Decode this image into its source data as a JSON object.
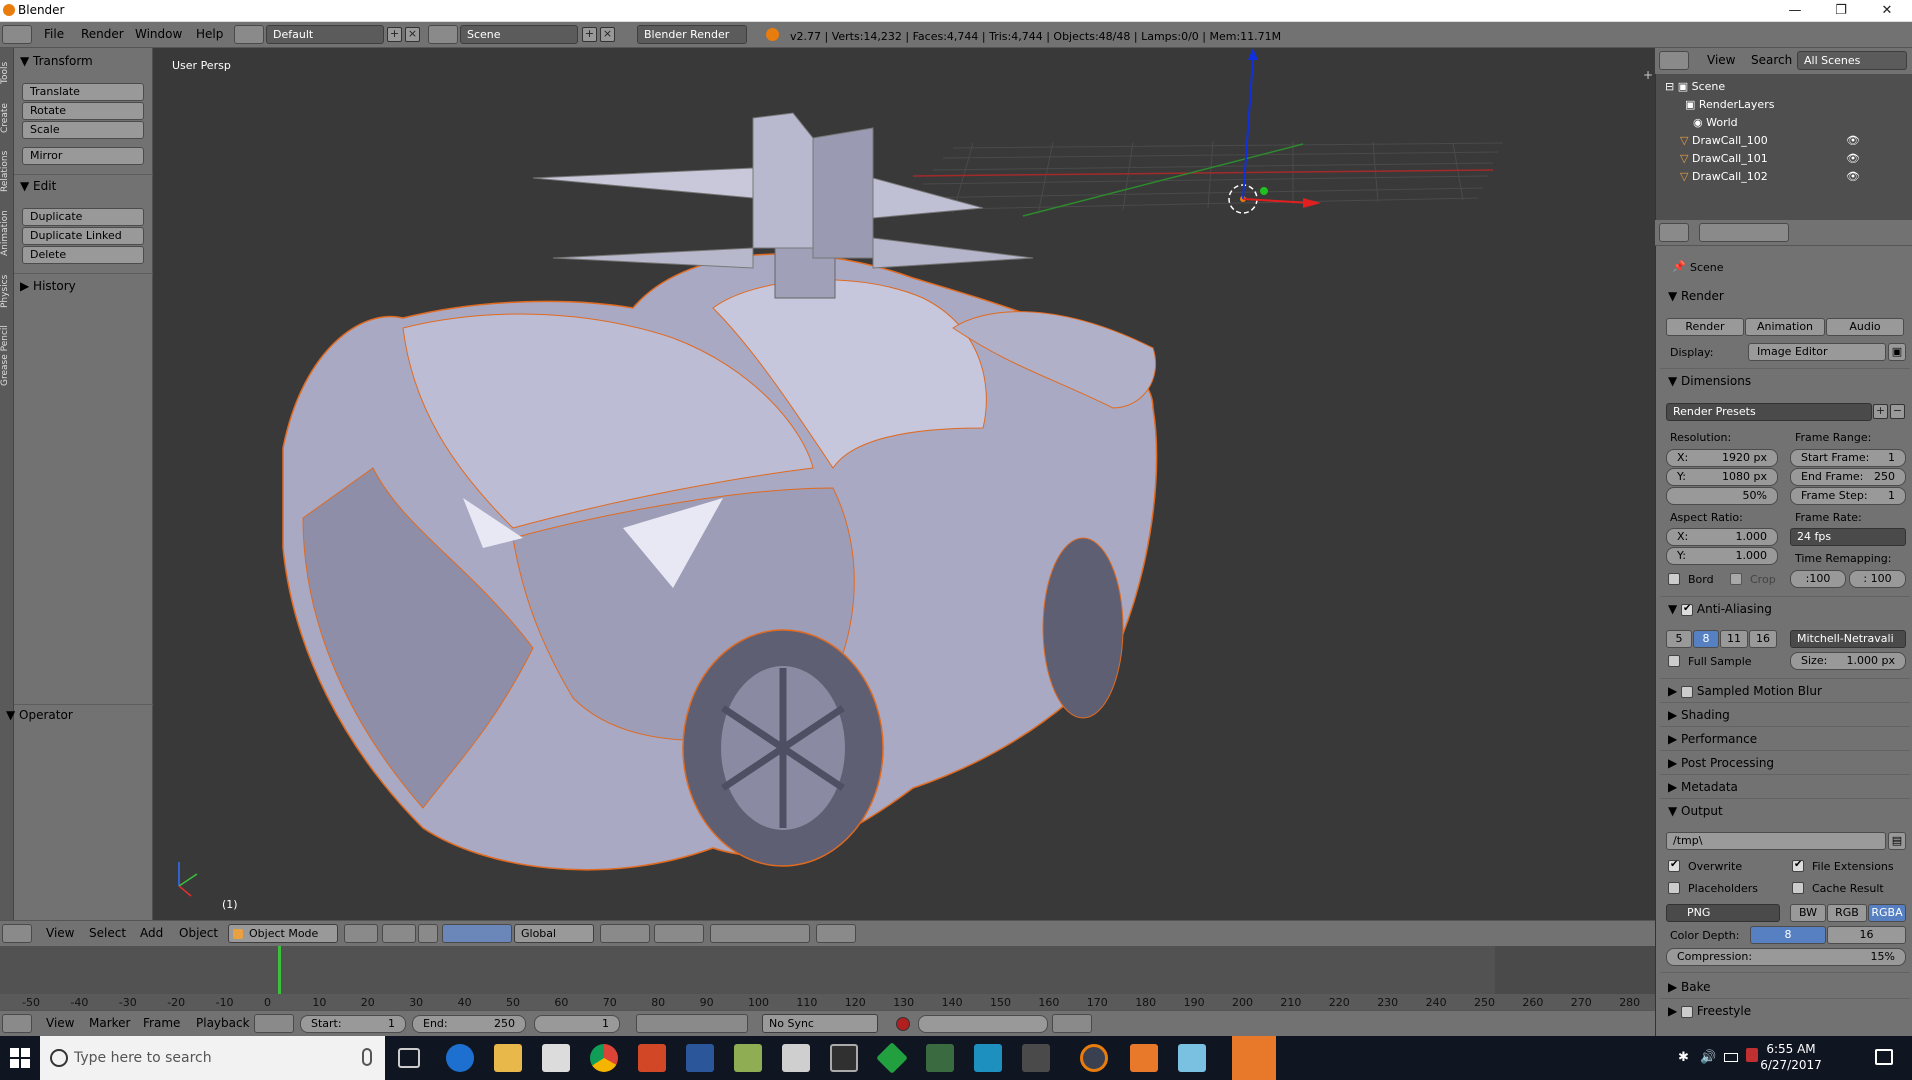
{
  "window": {
    "title": "Blender"
  },
  "header": {
    "menus": [
      "File",
      "Render",
      "Window",
      "Help"
    ],
    "layout": "Default",
    "scene": "Scene",
    "engine": "Blender Render",
    "stats": "v2.77 | Verts:14,232 | Faces:4,744 | Tris:4,744 | Objects:48/48 | Lamps:0/0 | Mem:11.71M"
  },
  "left_tabs": [
    "Tools",
    "Create",
    "Relations",
    "Animation",
    "Physics",
    "Grease Pencil"
  ],
  "toolshelf": {
    "transform": {
      "title": "Transform",
      "buttons": [
        "Translate",
        "Rotate",
        "Scale",
        "Mirror"
      ]
    },
    "edit": {
      "title": "Edit",
      "buttons": [
        "Duplicate",
        "Duplicate Linked",
        "Delete"
      ]
    },
    "history": "History",
    "operator": "Operator"
  },
  "viewport": {
    "label": "User Persp",
    "frame": "(1)"
  },
  "viewport_header": {
    "menus": [
      "View",
      "Select",
      "Add",
      "Object"
    ],
    "mode": "Object Mode",
    "orientation": "Global"
  },
  "timeline": {
    "ticks": [
      "-50",
      "-40",
      "-30",
      "-20",
      "-10",
      "0",
      "10",
      "20",
      "30",
      "40",
      "50",
      "60",
      "70",
      "80",
      "90",
      "100",
      "110",
      "120",
      "130",
      "140",
      "150",
      "160",
      "170",
      "180",
      "190",
      "200",
      "210",
      "220",
      "230",
      "240",
      "250",
      "260",
      "270",
      "280"
    ],
    "menus": [
      "View",
      "Marker",
      "Frame",
      "Playback"
    ],
    "start_label": "Start:",
    "start": "1",
    "end_label": "End:",
    "end": "250",
    "current": "1",
    "sync": "No Sync"
  },
  "outliner": {
    "menus": [
      "View",
      "Search"
    ],
    "filter": "All Scenes",
    "items": [
      "Scene",
      "RenderLayers",
      "World",
      "DrawCall_100",
      "DrawCall_101",
      "DrawCall_102"
    ]
  },
  "properties": {
    "context": "Scene",
    "render": {
      "title": "Render",
      "buttons": [
        "Render",
        "Animation",
        "Audio"
      ],
      "display_label": "Display:",
      "display": "Image Editor"
    },
    "dimensions": {
      "title": "Dimensions",
      "presets": "Render Presets",
      "resolution_label": "Resolution:",
      "res_x": "1920 px",
      "res_y": "1080 px",
      "res_pct": "50%",
      "frame_range_label": "Frame Range:",
      "start_frame": "Start Frame:",
      "start_frame_val": "1",
      "end_frame": "End Frame:",
      "end_frame_val": "250",
      "frame_step": "Frame Step:",
      "frame_step_val": "1",
      "aspect_label": "Aspect Ratio:",
      "asp_x": "1.000",
      "asp_y": "1.000",
      "frame_rate_label": "Frame Rate:",
      "frame_rate": "24 fps",
      "time_remap_label": "Time Remapping:",
      "remap_old": ":100",
      "remap_new": ": 100",
      "bord": "Bord",
      "crop": "Crop"
    },
    "anti_aliasing": {
      "title": "Anti-Aliasing",
      "samples": [
        "5",
        "8",
        "11",
        "16"
      ],
      "filter": "Mitchell-Netravali",
      "full_sample": "Full Sample",
      "size": "Size:",
      "size_val": "1.000 px"
    },
    "collapsed": [
      "Sampled Motion Blur",
      "Shading",
      "Performance",
      "Post Processing",
      "Metadata"
    ],
    "output": {
      "title": "Output",
      "path": "/tmp\\",
      "overwrite": "Overwrite",
      "file_ext": "File Extensions",
      "placeholders": "Placeholders",
      "cache": "Cache Result",
      "format": "PNG",
      "color_modes": [
        "BW",
        "RGB",
        "RGBA"
      ],
      "depth_label": "Color Depth:",
      "depth": [
        "8",
        "16"
      ],
      "compression": "Compression:",
      "compression_val": "15%"
    },
    "bake": "Bake",
    "freestyle": "Freestyle"
  },
  "taskbar": {
    "search": "Type here to search",
    "time": "6:55 AM",
    "date": "6/27/2017"
  }
}
